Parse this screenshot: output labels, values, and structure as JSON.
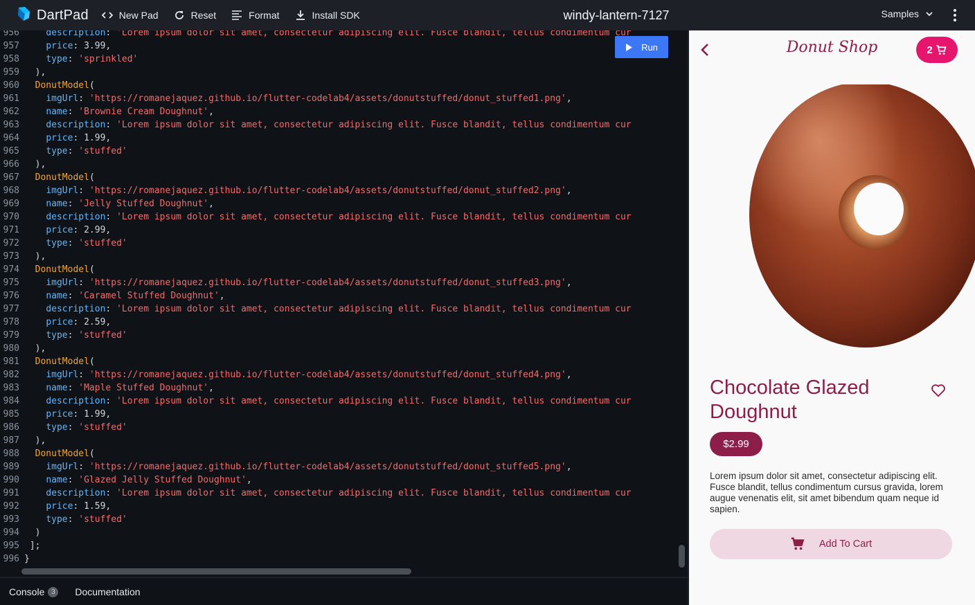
{
  "app": {
    "name": "DartPad",
    "pad_title": "windy-lantern-7127"
  },
  "toolbar": {
    "new_pad": "New Pad",
    "reset": "Reset",
    "format": "Format",
    "install_sdk": "Install SDK",
    "samples": "Samples"
  },
  "editor": {
    "run_label": "Run",
    "lines": [
      {
        "n": "956",
        "t": [
          [
            "    ",
            "pun"
          ],
          [
            "description",
            "key"
          ],
          [
            ": ",
            "pun"
          ],
          [
            "'Lorem ipsum dolor sit amet, consectetur adipiscing elit. Fusce blandit, tellus condimentum cur",
            "str"
          ]
        ]
      },
      {
        "n": "957",
        "t": [
          [
            "    ",
            "pun"
          ],
          [
            "price",
            "key"
          ],
          [
            ": 3.99,",
            "num"
          ]
        ]
      },
      {
        "n": "958",
        "t": [
          [
            "    ",
            "pun"
          ],
          [
            "type",
            "key"
          ],
          [
            ": ",
            "pun"
          ],
          [
            "'sprinkled'",
            "str"
          ]
        ]
      },
      {
        "n": "959",
        "t": [
          [
            "  ),",
            "pun"
          ]
        ]
      },
      {
        "n": "960",
        "t": [
          [
            "  ",
            "pun"
          ],
          [
            "DonutModel",
            "cls"
          ],
          [
            "(",
            "pun"
          ]
        ]
      },
      {
        "n": "961",
        "t": [
          [
            "    ",
            "pun"
          ],
          [
            "imgUrl",
            "key"
          ],
          [
            ": ",
            "pun"
          ],
          [
            "'https://romanejaquez.github.io/flutter-codelab4/assets/donutstuffed/donut_stuffed1.png'",
            "str"
          ],
          [
            ",",
            "pun"
          ]
        ]
      },
      {
        "n": "962",
        "t": [
          [
            "    ",
            "pun"
          ],
          [
            "name",
            "key"
          ],
          [
            ": ",
            "pun"
          ],
          [
            "'Brownie Cream Doughnut'",
            "str"
          ],
          [
            ",",
            "pun"
          ]
        ]
      },
      {
        "n": "963",
        "t": [
          [
            "    ",
            "pun"
          ],
          [
            "description",
            "key"
          ],
          [
            ": ",
            "pun"
          ],
          [
            "'Lorem ipsum dolor sit amet, consectetur adipiscing elit. Fusce blandit, tellus condimentum cur",
            "str"
          ]
        ]
      },
      {
        "n": "964",
        "t": [
          [
            "    ",
            "pun"
          ],
          [
            "price",
            "key"
          ],
          [
            ": 1.99,",
            "num"
          ]
        ]
      },
      {
        "n": "965",
        "t": [
          [
            "    ",
            "pun"
          ],
          [
            "type",
            "key"
          ],
          [
            ": ",
            "pun"
          ],
          [
            "'stuffed'",
            "str"
          ]
        ]
      },
      {
        "n": "966",
        "t": [
          [
            "  ),",
            "pun"
          ]
        ]
      },
      {
        "n": "967",
        "t": [
          [
            "  ",
            "pun"
          ],
          [
            "DonutModel",
            "cls"
          ],
          [
            "(",
            "pun"
          ]
        ]
      },
      {
        "n": "968",
        "t": [
          [
            "    ",
            "pun"
          ],
          [
            "imgUrl",
            "key"
          ],
          [
            ": ",
            "pun"
          ],
          [
            "'https://romanejaquez.github.io/flutter-codelab4/assets/donutstuffed/donut_stuffed2.png'",
            "str"
          ],
          [
            ",",
            "pun"
          ]
        ]
      },
      {
        "n": "969",
        "t": [
          [
            "    ",
            "pun"
          ],
          [
            "name",
            "key"
          ],
          [
            ": ",
            "pun"
          ],
          [
            "'Jelly Stuffed Doughnut'",
            "str"
          ],
          [
            ",",
            "pun"
          ]
        ]
      },
      {
        "n": "970",
        "t": [
          [
            "    ",
            "pun"
          ],
          [
            "description",
            "key"
          ],
          [
            ": ",
            "pun"
          ],
          [
            "'Lorem ipsum dolor sit amet, consectetur adipiscing elit. Fusce blandit, tellus condimentum cur",
            "str"
          ]
        ]
      },
      {
        "n": "971",
        "t": [
          [
            "    ",
            "pun"
          ],
          [
            "price",
            "key"
          ],
          [
            ": 2.99,",
            "num"
          ]
        ]
      },
      {
        "n": "972",
        "t": [
          [
            "    ",
            "pun"
          ],
          [
            "type",
            "key"
          ],
          [
            ": ",
            "pun"
          ],
          [
            "'stuffed'",
            "str"
          ]
        ]
      },
      {
        "n": "973",
        "t": [
          [
            "  ),",
            "pun"
          ]
        ]
      },
      {
        "n": "974",
        "t": [
          [
            "  ",
            "pun"
          ],
          [
            "DonutModel",
            "cls"
          ],
          [
            "(",
            "pun"
          ]
        ]
      },
      {
        "n": "975",
        "t": [
          [
            "    ",
            "pun"
          ],
          [
            "imgUrl",
            "key"
          ],
          [
            ": ",
            "pun"
          ],
          [
            "'https://romanejaquez.github.io/flutter-codelab4/assets/donutstuffed/donut_stuffed3.png'",
            "str"
          ],
          [
            ",",
            "pun"
          ]
        ]
      },
      {
        "n": "976",
        "t": [
          [
            "    ",
            "pun"
          ],
          [
            "name",
            "key"
          ],
          [
            ": ",
            "pun"
          ],
          [
            "'Caramel Stuffed Doughnut'",
            "str"
          ],
          [
            ",",
            "pun"
          ]
        ]
      },
      {
        "n": "977",
        "t": [
          [
            "    ",
            "pun"
          ],
          [
            "description",
            "key"
          ],
          [
            ": ",
            "pun"
          ],
          [
            "'Lorem ipsum dolor sit amet, consectetur adipiscing elit. Fusce blandit, tellus condimentum cur",
            "str"
          ]
        ]
      },
      {
        "n": "978",
        "t": [
          [
            "    ",
            "pun"
          ],
          [
            "price",
            "key"
          ],
          [
            ": 2.59,",
            "num"
          ]
        ]
      },
      {
        "n": "979",
        "t": [
          [
            "    ",
            "pun"
          ],
          [
            "type",
            "key"
          ],
          [
            ": ",
            "pun"
          ],
          [
            "'stuffed'",
            "str"
          ]
        ]
      },
      {
        "n": "980",
        "t": [
          [
            "  ),",
            "pun"
          ]
        ]
      },
      {
        "n": "981",
        "t": [
          [
            "  ",
            "pun"
          ],
          [
            "DonutModel",
            "cls"
          ],
          [
            "(",
            "pun"
          ]
        ]
      },
      {
        "n": "982",
        "t": [
          [
            "    ",
            "pun"
          ],
          [
            "imgUrl",
            "key"
          ],
          [
            ": ",
            "pun"
          ],
          [
            "'https://romanejaquez.github.io/flutter-codelab4/assets/donutstuffed/donut_stuffed4.png'",
            "str"
          ],
          [
            ",",
            "pun"
          ]
        ]
      },
      {
        "n": "983",
        "t": [
          [
            "    ",
            "pun"
          ],
          [
            "name",
            "key"
          ],
          [
            ": ",
            "pun"
          ],
          [
            "'Maple Stuffed Doughnut'",
            "str"
          ],
          [
            ",",
            "pun"
          ]
        ]
      },
      {
        "n": "984",
        "t": [
          [
            "    ",
            "pun"
          ],
          [
            "description",
            "key"
          ],
          [
            ": ",
            "pun"
          ],
          [
            "'Lorem ipsum dolor sit amet, consectetur adipiscing elit. Fusce blandit, tellus condimentum cur",
            "str"
          ]
        ]
      },
      {
        "n": "985",
        "t": [
          [
            "    ",
            "pun"
          ],
          [
            "price",
            "key"
          ],
          [
            ": 1.99,",
            "num"
          ]
        ]
      },
      {
        "n": "986",
        "t": [
          [
            "    ",
            "pun"
          ],
          [
            "type",
            "key"
          ],
          [
            ": ",
            "pun"
          ],
          [
            "'stuffed'",
            "str"
          ]
        ]
      },
      {
        "n": "987",
        "t": [
          [
            "  ),",
            "pun"
          ]
        ]
      },
      {
        "n": "988",
        "t": [
          [
            "  ",
            "pun"
          ],
          [
            "DonutModel",
            "cls"
          ],
          [
            "(",
            "pun"
          ]
        ]
      },
      {
        "n": "989",
        "t": [
          [
            "    ",
            "pun"
          ],
          [
            "imgUrl",
            "key"
          ],
          [
            ": ",
            "pun"
          ],
          [
            "'https://romanejaquez.github.io/flutter-codelab4/assets/donutstuffed/donut_stuffed5.png'",
            "str"
          ],
          [
            ",",
            "pun"
          ]
        ]
      },
      {
        "n": "990",
        "t": [
          [
            "    ",
            "pun"
          ],
          [
            "name",
            "key"
          ],
          [
            ": ",
            "pun"
          ],
          [
            "'Glazed Jelly Stuffed Doughnut'",
            "str"
          ],
          [
            ",",
            "pun"
          ]
        ]
      },
      {
        "n": "991",
        "t": [
          [
            "    ",
            "pun"
          ],
          [
            "description",
            "key"
          ],
          [
            ": ",
            "pun"
          ],
          [
            "'Lorem ipsum dolor sit amet, consectetur adipiscing elit. Fusce blandit, tellus condimentum cur",
            "str"
          ]
        ]
      },
      {
        "n": "992",
        "t": [
          [
            "    ",
            "pun"
          ],
          [
            "price",
            "key"
          ],
          [
            ": 1.59,",
            "num"
          ]
        ]
      },
      {
        "n": "993",
        "t": [
          [
            "    ",
            "pun"
          ],
          [
            "type",
            "key"
          ],
          [
            ": ",
            "pun"
          ],
          [
            "'stuffed'",
            "str"
          ]
        ]
      },
      {
        "n": "994",
        "t": [
          [
            "  )",
            "pun"
          ]
        ]
      },
      {
        "n": "995",
        "t": [
          [
            " ];",
            "pun"
          ]
        ]
      },
      {
        "n": "996",
        "t": [
          [
            "}",
            "pun"
          ]
        ]
      }
    ]
  },
  "bottom": {
    "console": "Console",
    "console_count": "3",
    "documentation": "Documentation"
  },
  "preview": {
    "shop_title": "Donut Shop",
    "cart_count": "2",
    "product_name": "Chocolate Glazed Doughnut",
    "price": "$2.99",
    "description": "Lorem ipsum dolor sit amet, consectetur adipiscing elit. Fusce blandit, tellus condimentum cursus gravida, lorem augue venenatis elit, sit amet bibendum quam neque id sapien.",
    "add_to_cart": "Add To Cart"
  },
  "colors": {
    "accent_blue": "#3b77f6",
    "brand_primary": "#8d1e49",
    "cart_badge": "#e6166e",
    "code_class": "#f0a63b",
    "code_key": "#64b5f6",
    "code_string": "#f26b6b"
  },
  "icons": {
    "logo": "dart-logo-icon",
    "new_pad": "code-brackets-icon",
    "reset": "refresh-icon",
    "format": "format-lines-icon",
    "install": "download-icon",
    "samples": "chevron-down-icon",
    "menu": "more-vert-icon",
    "run": "play-icon",
    "back": "chevron-left-icon",
    "cart": "shopping-cart-icon",
    "favorite": "heart-outline-icon"
  }
}
